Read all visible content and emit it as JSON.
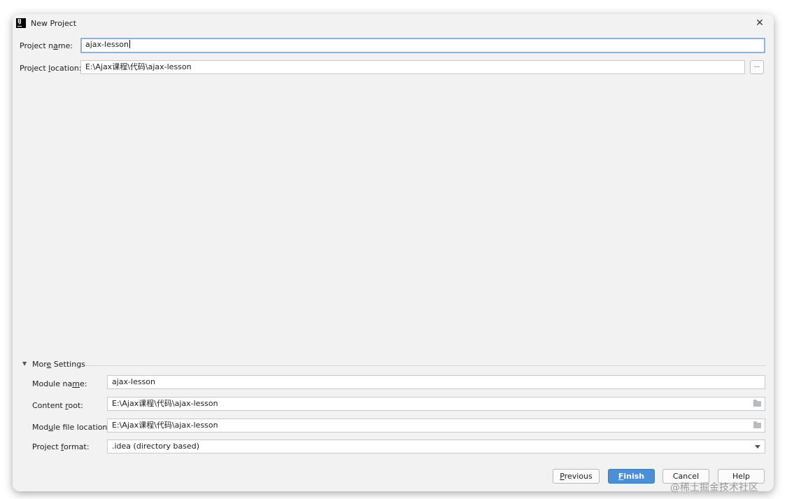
{
  "window": {
    "title": "New Project",
    "close_glyph": "✕"
  },
  "project_name": {
    "label": "Project name:",
    "value": "ajax-lesson"
  },
  "project_location": {
    "label": "Project location:",
    "value": "E:\\Ajax课程\\代码\\ajax-lesson",
    "browse_label": "..."
  },
  "more_settings": {
    "label": "More Settings",
    "module_name": {
      "label": "Module name:",
      "value": "ajax-lesson"
    },
    "content_root": {
      "label": "Content root:",
      "value": "E:\\Ajax课程\\代码\\ajax-lesson"
    },
    "module_file_location": {
      "label": "Module file location:",
      "value": "E:\\Ajax课程\\代码\\ajax-lesson"
    },
    "project_format": {
      "label": "Project format:",
      "value": ".idea (directory based)"
    }
  },
  "buttons": {
    "previous": "Previous",
    "finish": "Finish",
    "cancel": "Cancel",
    "help": "Help"
  },
  "watermark": "@稀土掘金技术社区",
  "icons": {
    "app": "intellij-idea-icon",
    "folder": "folder-icon",
    "dropdown": "chevron-down-icon",
    "expand": "triangle-down-icon"
  },
  "colors": {
    "dialog_bg": "#f2f2f2",
    "focus_border": "#8bb3e0",
    "primary_button": "#4a8fd8"
  }
}
